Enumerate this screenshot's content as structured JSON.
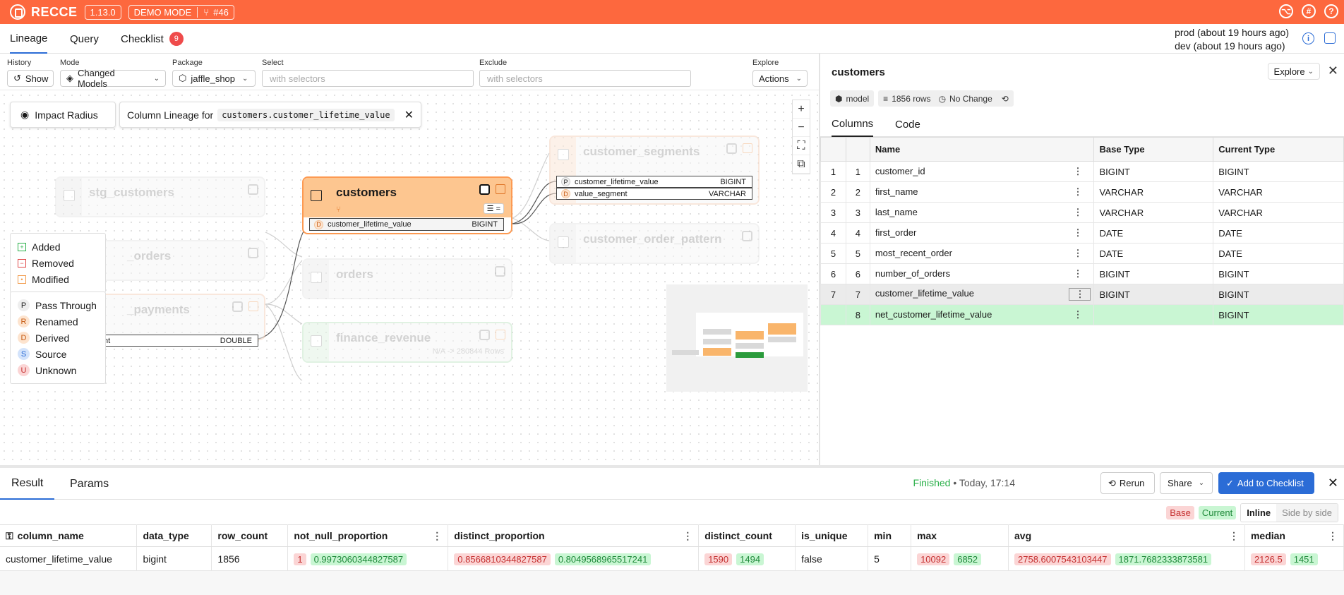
{
  "topbar": {
    "brand": "RECCE",
    "version": "1.13.0",
    "mode": "DEMO MODE",
    "pr": "#46",
    "accent": "#fd683e"
  },
  "tabs": {
    "lineage": "Lineage",
    "query": "Query",
    "checklist": "Checklist",
    "checklist_count": "9"
  },
  "env": {
    "prod": "prod (about 19 hours ago)",
    "dev": "dev (about 19 hours ago)"
  },
  "filters": {
    "history_label": "History",
    "history_value": "Show",
    "mode_label": "Mode",
    "mode_value": "Changed Models",
    "package_label": "Package",
    "package_value": "jaffle_shop",
    "select_label": "Select",
    "select_placeholder": "with selectors",
    "exclude_label": "Exclude",
    "exclude_placeholder": "with selectors",
    "explore_label": "Explore",
    "explore_value": "Actions"
  },
  "canvas": {
    "impact_radius": "Impact Radius",
    "column_lineage_prefix": "Column Lineage for",
    "column_lineage_target": "customers.customer_lifetime_value",
    "nodes": {
      "stg_customers": "stg_customers",
      "orders_partial": "_orders",
      "payments_partial": "_payments",
      "customers": "customers",
      "orders": "orders",
      "finance_revenue": "finance_revenue",
      "finance_rows": "N/A -> 280844 Rows",
      "customer_segments": "customer_segments",
      "customer_order_pattern": "customer_order_pattern"
    },
    "columns": {
      "customers_col": {
        "tag": "D",
        "name": "customer_lifetime_value",
        "type": "BIGINT"
      },
      "payments_col": {
        "name": "nt",
        "type": "DOUBLE"
      },
      "seg_col1": {
        "tag": "P",
        "name": "customer_lifetime_value",
        "type": "BIGINT"
      },
      "seg_col2": {
        "tag": "D",
        "name": "value_segment",
        "type": "VARCHAR"
      }
    },
    "legend_change": [
      "Added",
      "Removed",
      "Modified"
    ],
    "legend_transform": [
      {
        "tag": "P",
        "label": "Pass Through"
      },
      {
        "tag": "R",
        "label": "Renamed"
      },
      {
        "tag": "D",
        "label": "Derived"
      },
      {
        "tag": "S",
        "label": "Source"
      },
      {
        "tag": "U",
        "label": "Unknown"
      }
    ]
  },
  "details": {
    "title": "customers",
    "explore": "Explore",
    "resource": "model",
    "rows": "1856 rows",
    "change": "No Change",
    "tab_columns": "Columns",
    "tab_code": "Code",
    "headers": [
      "Name",
      "Base Type",
      "Current Type"
    ],
    "rows_data": [
      {
        "base_idx": "1",
        "cur_idx": "1",
        "name": "customer_id",
        "base": "BIGINT",
        "current": "BIGINT"
      },
      {
        "base_idx": "2",
        "cur_idx": "2",
        "name": "first_name",
        "base": "VARCHAR",
        "current": "VARCHAR"
      },
      {
        "base_idx": "3",
        "cur_idx": "3",
        "name": "last_name",
        "base": "VARCHAR",
        "current": "VARCHAR"
      },
      {
        "base_idx": "4",
        "cur_idx": "4",
        "name": "first_order",
        "base": "DATE",
        "current": "DATE"
      },
      {
        "base_idx": "5",
        "cur_idx": "5",
        "name": "most_recent_order",
        "base": "DATE",
        "current": "DATE"
      },
      {
        "base_idx": "6",
        "cur_idx": "6",
        "name": "number_of_orders",
        "base": "BIGINT",
        "current": "BIGINT"
      },
      {
        "base_idx": "7",
        "cur_idx": "7",
        "name": "customer_lifetime_value",
        "base": "BIGINT",
        "current": "BIGINT"
      },
      {
        "base_idx": "",
        "cur_idx": "8",
        "name": "net_customer_lifetime_value",
        "base": "",
        "current": "BIGINT"
      }
    ]
  },
  "result": {
    "tab_result": "Result",
    "tab_params": "Params",
    "status_ok": "Finished",
    "status_time": "• Today, 17:14",
    "rerun": "Rerun",
    "share": "Share",
    "add_checklist": "Add to Checklist",
    "chip_base": "Base",
    "chip_current": "Current",
    "view_inline": "Inline",
    "view_side": "Side by side",
    "headers": [
      "column_name",
      "data_type",
      "row_count",
      "not_null_proportion",
      "distinct_proportion",
      "distinct_count",
      "is_unique",
      "min",
      "max",
      "avg",
      "median"
    ],
    "row": {
      "column_name": "customer_lifetime_value",
      "data_type": "bigint",
      "row_count": "1856",
      "not_null_base": "1",
      "not_null_cur": "0.9973060344827587",
      "distinct_prop_base": "0.8566810344827587",
      "distinct_prop_cur": "0.8049568965517241",
      "distinct_count_base": "1590",
      "distinct_count_cur": "1494",
      "is_unique": "false",
      "min": "5",
      "max_base": "10092",
      "max_cur": "6852",
      "avg_base": "2758.6007543103447",
      "avg_cur": "1871.7682333873581",
      "median_base": "2126.5",
      "median_cur": "1451"
    }
  }
}
